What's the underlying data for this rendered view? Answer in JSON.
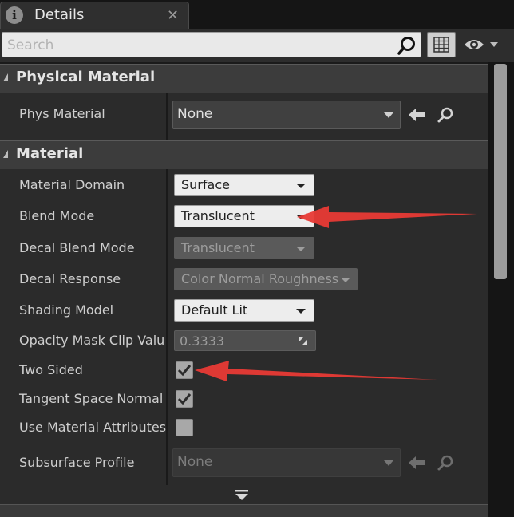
{
  "tab": {
    "title": "Details",
    "info_glyph": "i",
    "close_glyph": "✕"
  },
  "search": {
    "placeholder": "Search",
    "value": ""
  },
  "toolbar": {
    "grid_icon": "property-matrix-icon",
    "eye_icon": "visibility-options-icon"
  },
  "physical_material": {
    "header": "Physical Material",
    "phys_material": {
      "label": "Phys Material",
      "value": "None"
    }
  },
  "material": {
    "header": "Material",
    "material_domain": {
      "label": "Material Domain",
      "value": "Surface"
    },
    "blend_mode": {
      "label": "Blend Mode",
      "value": "Translucent"
    },
    "decal_blend_mode": {
      "label": "Decal Blend Mode",
      "value": "Translucent"
    },
    "decal_response": {
      "label": "Decal Response",
      "value": "Color Normal Roughness"
    },
    "shading_model": {
      "label": "Shading Model",
      "value": "Default Lit"
    },
    "opacity_mask_clip": {
      "label": "Opacity Mask Clip Valu",
      "value": "0.3333"
    },
    "two_sided": {
      "label": "Two Sided",
      "checked": true
    },
    "tangent_space_normal": {
      "label": "Tangent Space Normal",
      "checked": true
    },
    "use_material_attributes": {
      "label": "Use Material Attributes",
      "checked": false
    },
    "subsurface_profile": {
      "label": "Subsurface Profile",
      "value": "None"
    }
  },
  "annotation_color": "#e83a35"
}
